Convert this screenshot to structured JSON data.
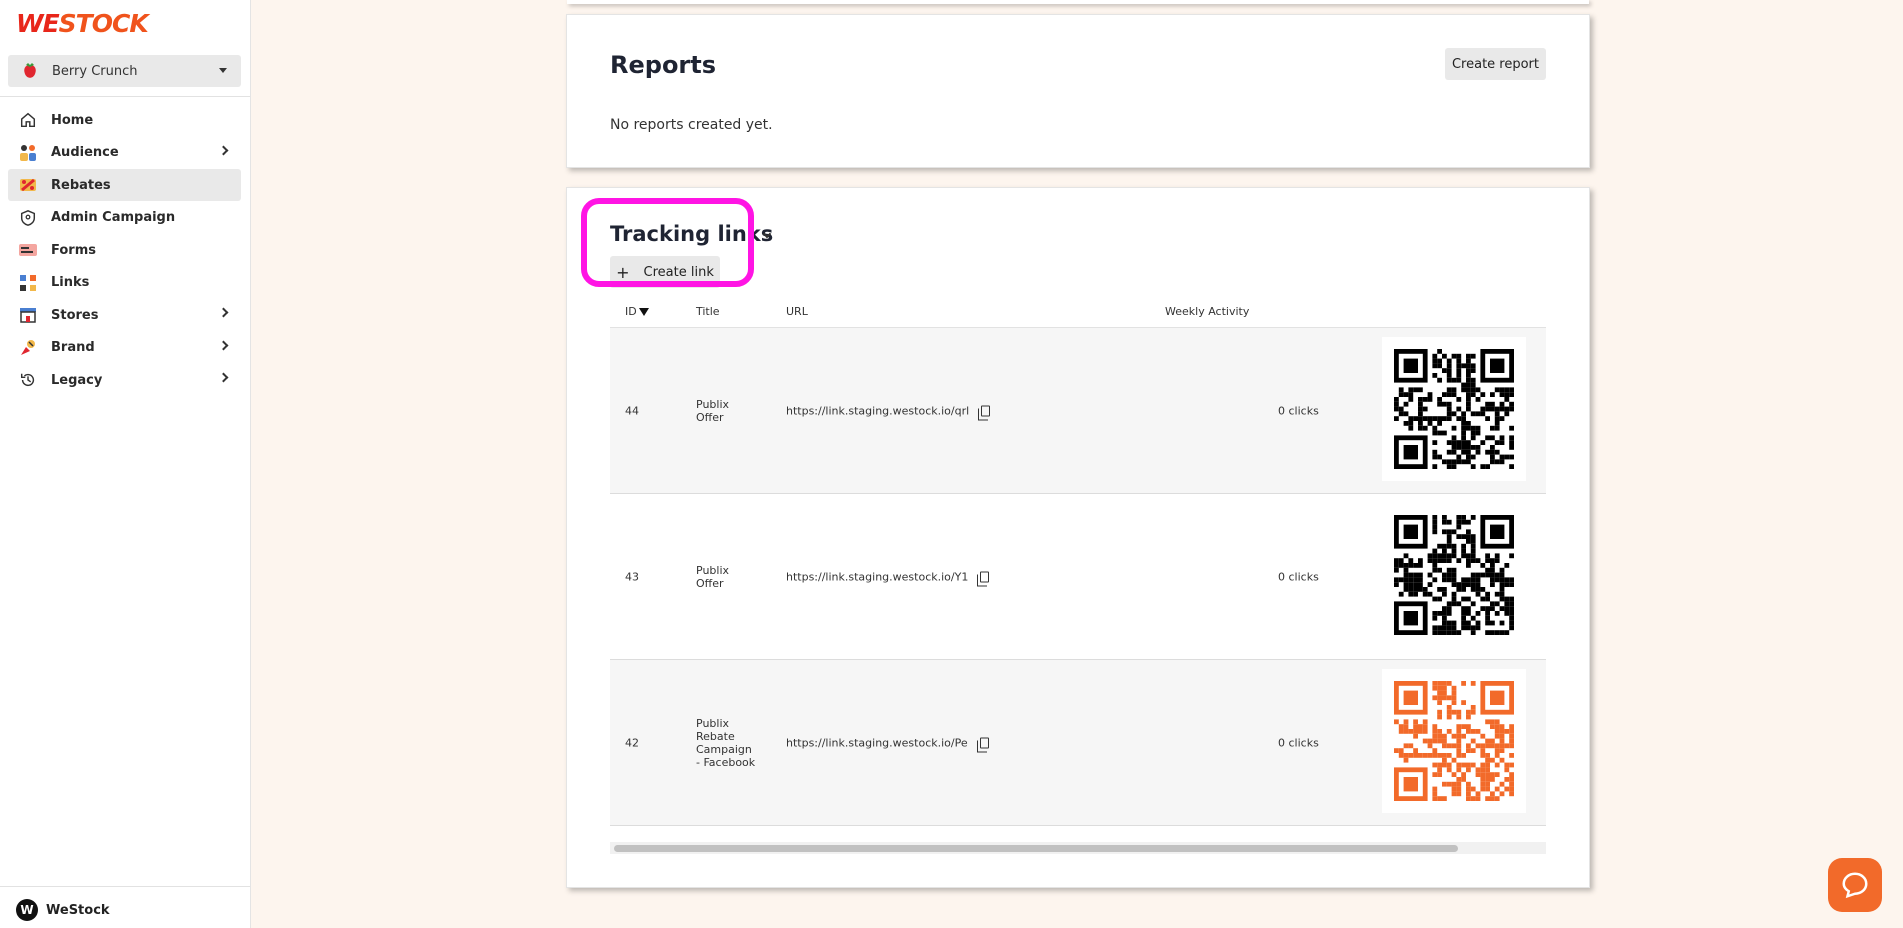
{
  "app": {
    "logo_text_we": "WE",
    "logo_text_stock": "STOCK",
    "selected_brand": "Berry Crunch",
    "org_initial": "W",
    "org_name": "WeStock",
    "accent_color": "#f26a2a",
    "highlight_color": "#ff14e4"
  },
  "sidebar": {
    "items": [
      {
        "label": "Home",
        "icon": "home-icon",
        "has_children": false,
        "active": false
      },
      {
        "label": "Audience",
        "icon": "audience-icon",
        "has_children": true,
        "active": false
      },
      {
        "label": "Rebates",
        "icon": "rebates-icon",
        "has_children": false,
        "active": true
      },
      {
        "label": "Admin Campaign",
        "icon": "shield-icon",
        "has_children": false,
        "active": false
      },
      {
        "label": "Forms",
        "icon": "forms-icon",
        "has_children": false,
        "active": false
      },
      {
        "label": "Links",
        "icon": "links-icon",
        "has_children": false,
        "active": false
      },
      {
        "label": "Stores",
        "icon": "store-icon",
        "has_children": true,
        "active": false
      },
      {
        "label": "Brand",
        "icon": "brand-icon",
        "has_children": true,
        "active": false
      },
      {
        "label": "Legacy",
        "icon": "history-icon",
        "has_children": true,
        "active": false
      }
    ]
  },
  "reports": {
    "title": "Reports",
    "create_label": "Create report",
    "empty_text": "No reports created yet."
  },
  "tracking": {
    "title": "Tracking links",
    "create_label": "Create link",
    "columns": {
      "id": "ID",
      "title": "Title",
      "url": "URL",
      "activity": "Weekly Activity"
    },
    "rows": [
      {
        "id": "44",
        "title": "Publix Offer",
        "url": "https://link.staging.westock.io/qrl",
        "clicks": "0 clicks",
        "qr_color": "#000000"
      },
      {
        "id": "43",
        "title": "Publix Offer",
        "url": "https://link.staging.westock.io/Y1",
        "clicks": "0 clicks",
        "qr_color": "#000000"
      },
      {
        "id": "42",
        "title": "Publix Rebate Campaign - Facebook",
        "url": "https://link.staging.westock.io/Pe",
        "clicks": "0 clicks",
        "qr_color": "#f26a2a"
      }
    ]
  }
}
